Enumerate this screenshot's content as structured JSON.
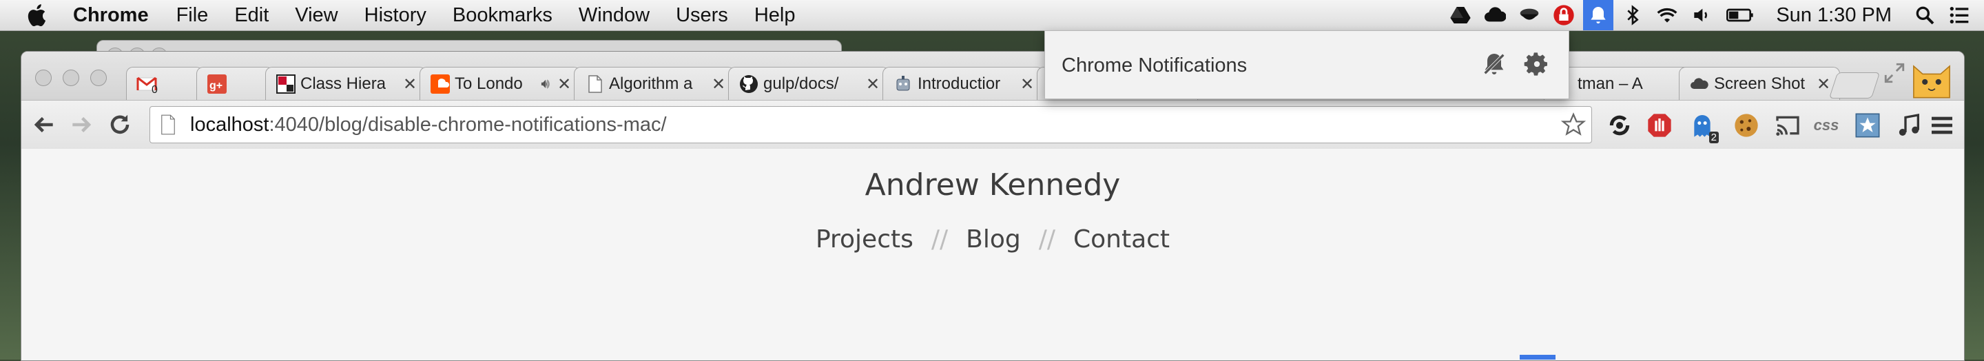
{
  "menubar": {
    "app_name": "Chrome",
    "menus": [
      "File",
      "Edit",
      "View",
      "History",
      "Bookmarks",
      "Window",
      "Users",
      "Help"
    ],
    "status_icons": [
      "google-drive-icon",
      "cloud-icon",
      "coffee-cup-icon",
      "lock-badge-icon",
      "notification-bell-icon",
      "bluetooth-icon",
      "wifi-icon",
      "volume-icon",
      "battery-icon"
    ],
    "clock": "Sun 1:30 PM"
  },
  "tabs": [
    {
      "title": "",
      "icon": "gmail-icon",
      "badge": "0"
    },
    {
      "title": "",
      "icon": "google-plus-icon"
    },
    {
      "title": "Class Hiera",
      "icon": "class-hierarchy-icon"
    },
    {
      "title": "To Londo",
      "icon": "soundcloud-icon",
      "audio": true
    },
    {
      "title": "Algorithm a",
      "icon": "page-icon"
    },
    {
      "title": "gulp/docs/",
      "icon": "github-icon"
    },
    {
      "title": "Introductior",
      "icon": "robot-icon"
    },
    {
      "title": "tman – A",
      "icon": "page-icon"
    },
    {
      "title": "Screen Shot",
      "icon": "cloud-app-icon"
    }
  ],
  "omnibox": {
    "host": "localhost",
    "path": ":4040/blog/disable-chrome-notifications-mac/"
  },
  "extensions": {
    "css_label": "css",
    "ghostery_badge": "2",
    "items": [
      "sync-icon",
      "adblock-hand-icon",
      "ghostery-icon",
      "cookie-icon",
      "cast-icon",
      "css-icon",
      "bookmark-star-icon",
      "music-note-icon",
      "menu-icon"
    ]
  },
  "page": {
    "site_title": "Andrew Kennedy",
    "nav": [
      "Projects",
      "Blog",
      "Contact"
    ],
    "separator": "//"
  },
  "notifications_popup": {
    "title": "Chrome Notifications"
  },
  "colors": {
    "menubar_active": "#3c78e6",
    "page_bg": "#f5f5f5",
    "gmail_red": "#d93025",
    "gplus_red": "#dd4b39",
    "soundcloud_orange": "#ff5500"
  }
}
